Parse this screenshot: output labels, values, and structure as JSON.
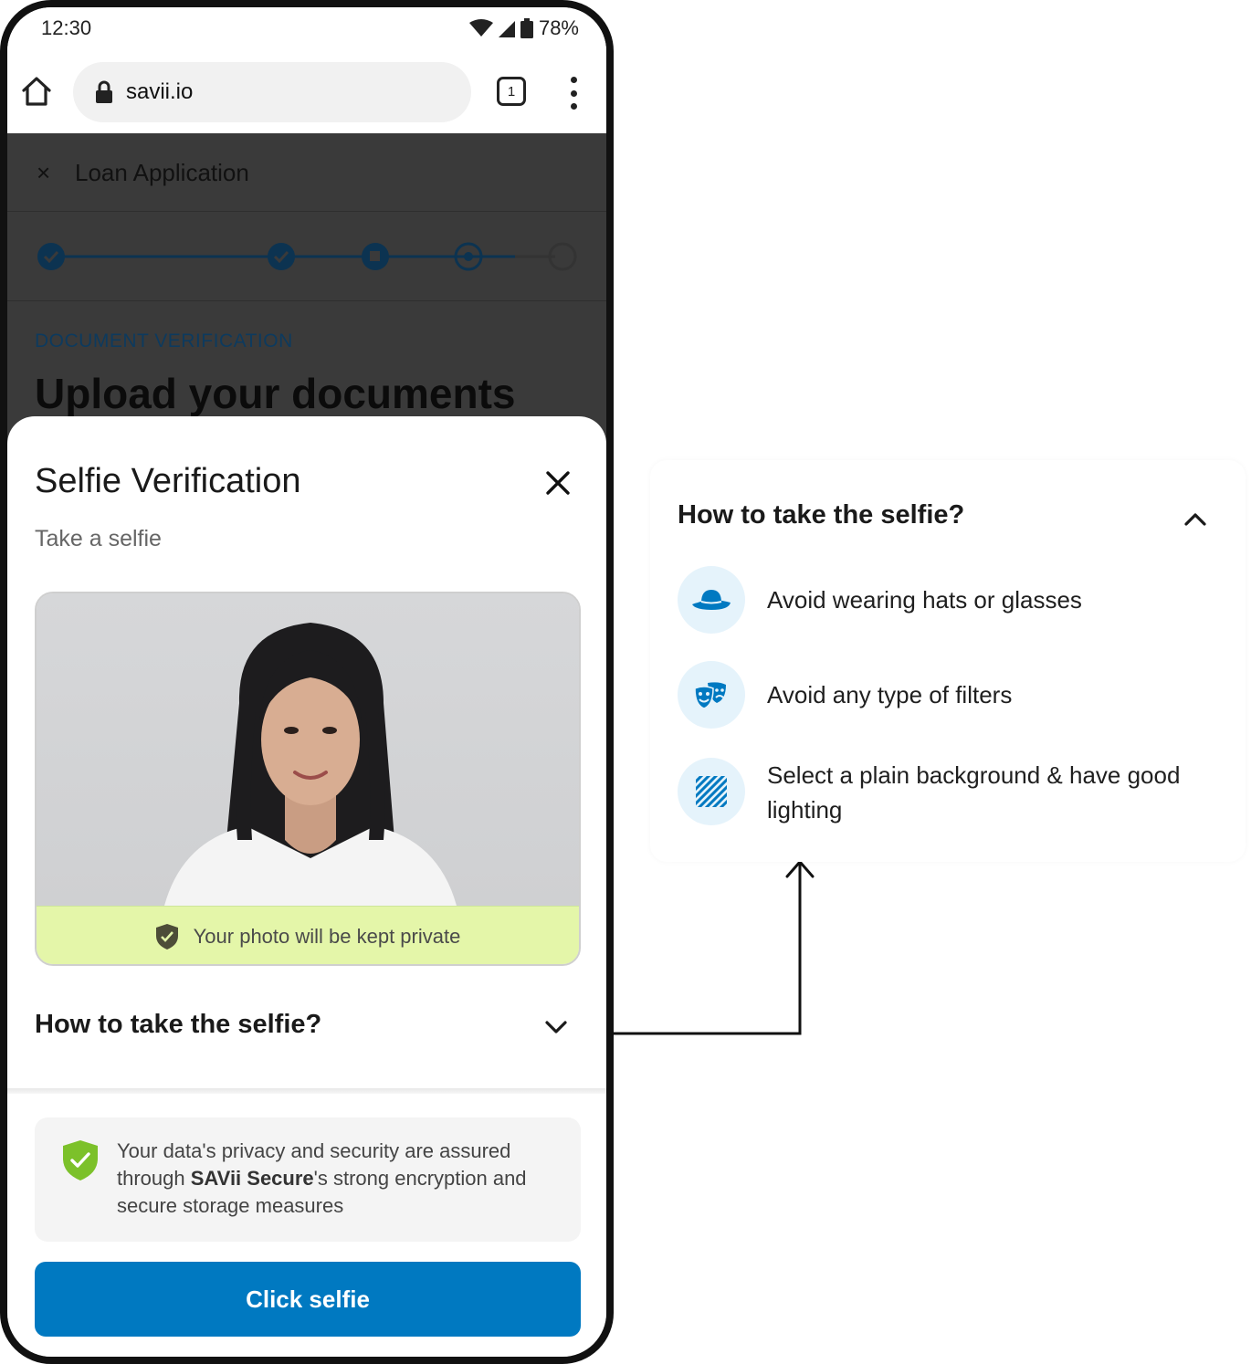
{
  "status_bar": {
    "time": "12:30",
    "battery": "78%"
  },
  "browser": {
    "url": "savii.io",
    "tab_count": "1"
  },
  "app": {
    "close_glyph": "×",
    "title": "Loan Application",
    "section_label": "DOCUMENT VERIFICATION",
    "heading": "Upload your documents",
    "steps": [
      "complete",
      "complete",
      "current",
      "current",
      "pending"
    ]
  },
  "sheet": {
    "title": "Selfie Verification",
    "subtitle": "Take a selfie",
    "privacy_note": "Your photo will be kept private",
    "howto_title": "How to take the selfie?",
    "secure_text_1": "Your data's privacy and security are assured through ",
    "secure_brand": "SAVii Secure",
    "secure_text_2": "'s strong encryption and secure storage measures",
    "cta_label": "Click selfie"
  },
  "panel": {
    "title": "How to take the selfie?",
    "tips": [
      {
        "icon": "hat-icon",
        "text": "Avoid wearing hats or glasses"
      },
      {
        "icon": "masks-icon",
        "text": "Avoid any type of filters"
      },
      {
        "icon": "plain-background-icon",
        "text": "Select a plain background & have good lighting"
      }
    ]
  },
  "colors": {
    "primary": "#0079c1",
    "privacy_strip": "#e4f6a9",
    "shield_green": "#7cc12a",
    "icon_bg": "#e5f3fb",
    "step_dark": "#0c3351"
  }
}
